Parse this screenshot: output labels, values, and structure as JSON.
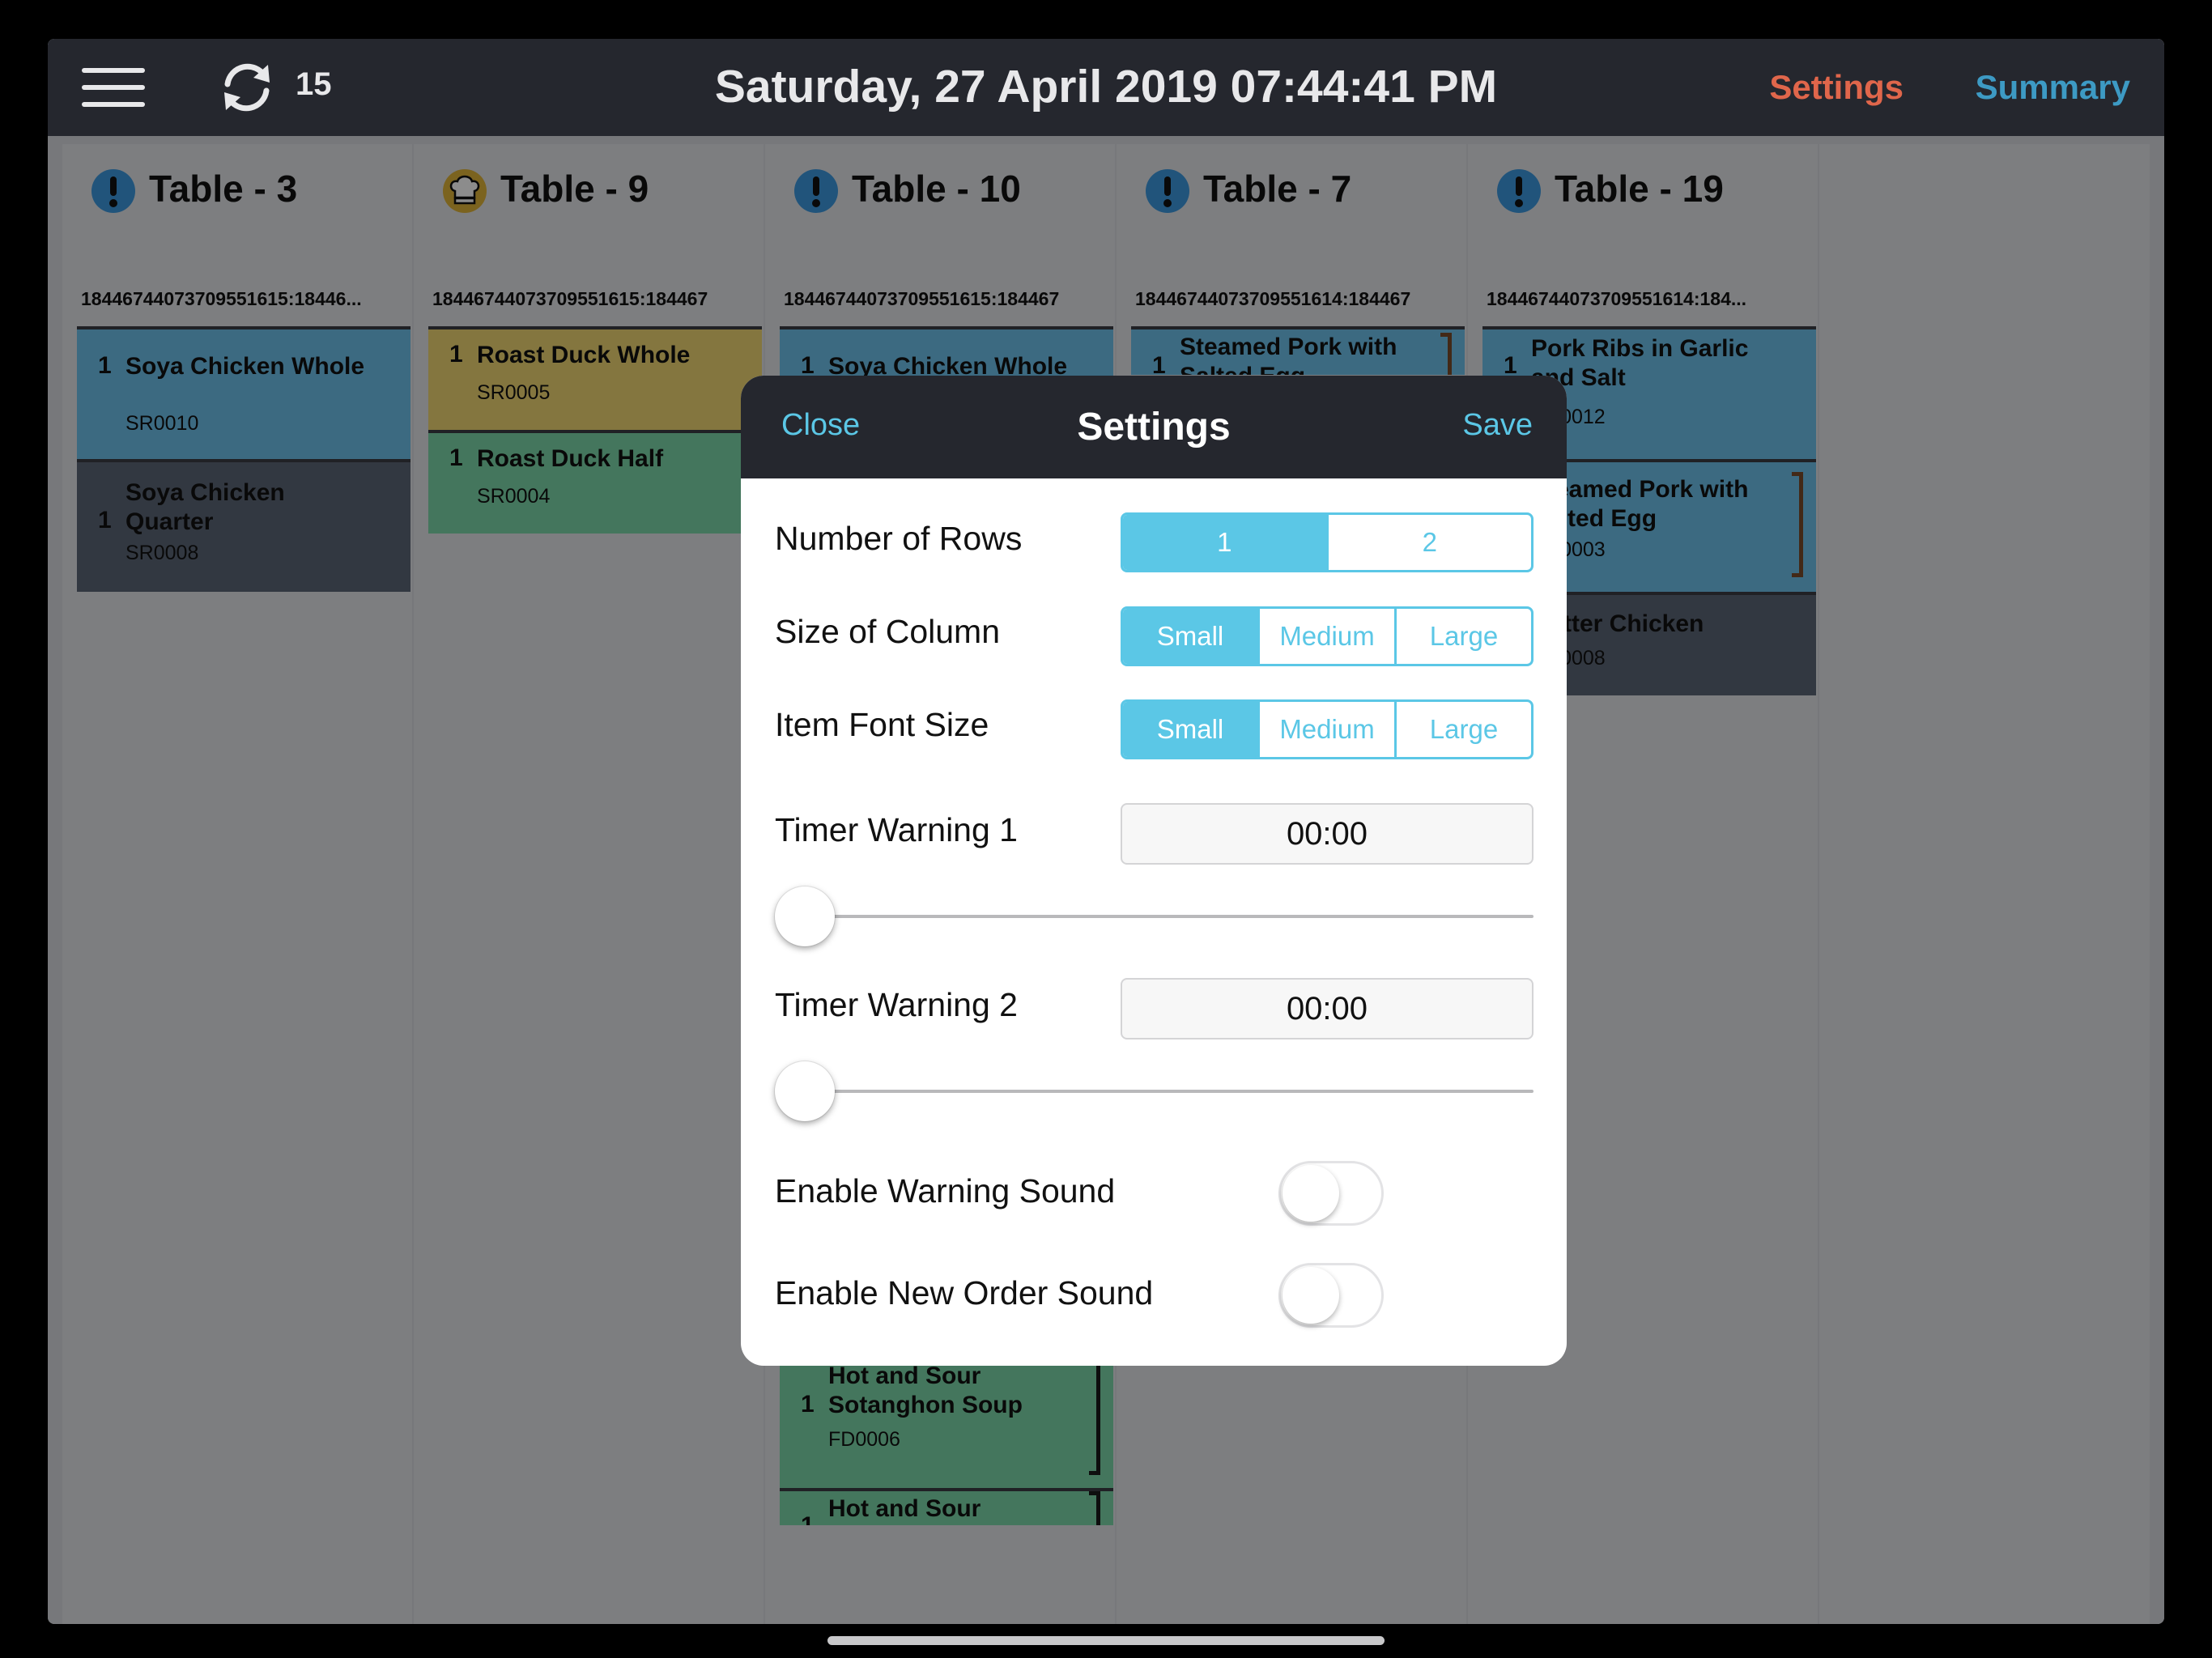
{
  "topbar": {
    "sync_count": "15",
    "datetime": "Saturday, 27 April 2019 07:44:41 PM",
    "settings_label": "Settings",
    "summary_label": "Summary",
    "settings_color": "#e0664b",
    "summary_color": "#3d9ac4"
  },
  "columns": [
    {
      "title": "Table - 3",
      "id": "18446744073709551615:18446...",
      "icon": "alert-icon",
      "cards": [
        {
          "qty": "1",
          "name": "Soya Chicken Whole",
          "code": "SR0010",
          "color": "#6dc1ec"
        },
        {
          "qty": "1",
          "name": "Soya Chicken Quarter",
          "code": "SR0008",
          "color": "#5c6677"
        }
      ]
    },
    {
      "title": "Table - 9",
      "id": "18446744073709551615:184467",
      "icon": "chef-hat-icon",
      "cards": [
        {
          "qty": "1",
          "name": "Roast Duck Whole",
          "code": "SR0005",
          "color": "#f1d874"
        },
        {
          "qty": "1",
          "name": "Roast Duck Half",
          "code": "SR0004",
          "color": "#7dd8a9"
        }
      ]
    },
    {
      "title": "Table - 10",
      "id": "18446744073709551615:184467",
      "icon": "alert-icon",
      "cards": [
        {
          "qty": "1",
          "name": "Soya Chicken Whole",
          "code": "",
          "color": "#6dc1ec"
        },
        {
          "qty": "1",
          "name": "Hot and Sour Sotanghon Soup",
          "code": "FD0006",
          "color": "#7dd8a9"
        },
        {
          "qty": "1",
          "name": "Hot and Sour",
          "code": "",
          "color": "#7dd8a9"
        }
      ]
    },
    {
      "title": "Table - 7",
      "id": "18446744073709551614:184467",
      "icon": "alert-icon",
      "cards": [
        {
          "qty": "1",
          "name": "Steamed Pork with Salted Egg",
          "code": "",
          "color": "#6dc1ec"
        }
      ]
    },
    {
      "title": "Table - 19",
      "id": "18446744073709551614:184...",
      "icon": "alert-icon",
      "cards": [
        {
          "qty": "1",
          "name": "Pork Ribs in Garlic and Salt",
          "code": "MT0012",
          "color": "#6dc1ec"
        },
        {
          "qty": "",
          "name": "Steamed Pork with Salted Egg",
          "code": "MT0003",
          "color": "#6dc1ec"
        },
        {
          "qty": "",
          "name": "Butter Chicken",
          "code": "MT0008",
          "color": "#5c6677"
        }
      ]
    }
  ],
  "modal": {
    "close_label": "Close",
    "title": "Settings",
    "save_label": "Save",
    "rows_label": "Number of Rows",
    "rows_options": [
      "1",
      "2"
    ],
    "column_size_label": "Size of Column",
    "column_size_options": [
      "Small",
      "Medium",
      "Large"
    ],
    "font_size_label": "Item Font Size",
    "font_size_options": [
      "Small",
      "Medium",
      "Large"
    ],
    "timer1_label": "Timer Warning 1",
    "timer1_value": "00:00",
    "timer1_slider": 0,
    "timer2_label": "Timer Warning 2",
    "timer2_value": "00:00",
    "timer2_slider": 0,
    "warning_sound_label": "Enable Warning Sound",
    "warning_sound_on": false,
    "new_order_sound_label": "Enable New Order Sound",
    "new_order_sound_on": false,
    "accent_color": "#5bc7e6"
  }
}
